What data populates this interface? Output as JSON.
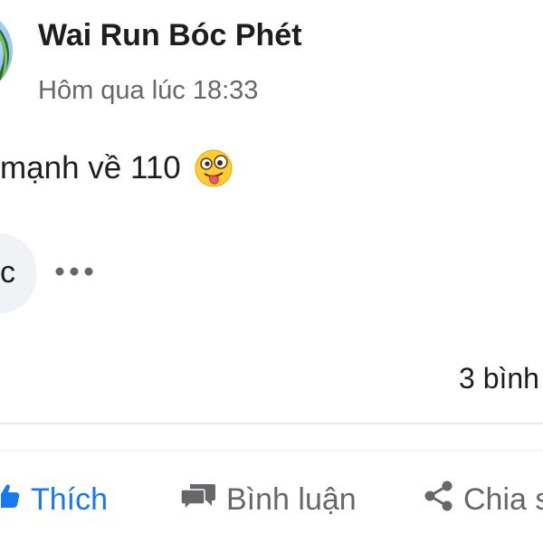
{
  "post": {
    "author": "Wai Run Bóc Phét",
    "time": "Hôm qua lúc 18:33",
    "text": "mạnh về 110",
    "emoji": "zany-face"
  },
  "reaction_bubble": {
    "text": "c"
  },
  "stats": {
    "comments": "3 bình"
  },
  "actions": {
    "like": "Thích",
    "comment": "Bình luận",
    "share": "Chia s"
  },
  "colors": {
    "accent": "#1877f2",
    "text": "#1c1e21",
    "secondary": "#65676b",
    "divider": "#e4e6eb"
  },
  "icons": {
    "like": "thumbs-up-icon",
    "comment": "speech-bubble-icon",
    "share": "share-icon",
    "more": "more-dots-icon"
  }
}
